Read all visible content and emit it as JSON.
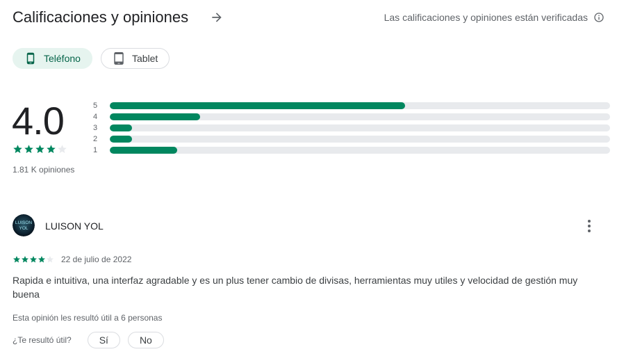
{
  "header": {
    "title": "Calificaciones y opiniones",
    "verified_text": "Las calificaciones y opiniones están verificadas",
    "arrow_icon": "arrow-right-icon",
    "info_icon": "info-icon"
  },
  "device_tabs": [
    {
      "label": "Teléfono",
      "icon": "phone-icon",
      "selected": true
    },
    {
      "label": "Tablet",
      "icon": "tablet-icon",
      "selected": false
    }
  ],
  "summary": {
    "score": "4.0",
    "stars_filled": 4,
    "stars_total": 5,
    "count_text": "1.81 K opiniones"
  },
  "distribution": [
    {
      "label": "5",
      "fraction": 0.59
    },
    {
      "label": "4",
      "fraction": 0.18
    },
    {
      "label": "3",
      "fraction": 0.045
    },
    {
      "label": "2",
      "fraction": 0.045
    },
    {
      "label": "1",
      "fraction": 0.135
    }
  ],
  "review": {
    "author": "LUISON YOL",
    "avatar_text_top": "LUISON",
    "avatar_text_bottom": "YOL",
    "rating": 4,
    "date": "22 de julio de 2022",
    "text": "Rapida e intuitiva, una interfaz agradable y es un plus tener cambio de divisas, herramientas muy utiles y velocidad de gestión muy buena",
    "helpful_count_text": "Esta opinión les resultó útil a 6 personas",
    "helpful_question": "¿Te resultó útil?",
    "yes_label": "Sí",
    "no_label": "No"
  },
  "colors": {
    "accent": "#01875f",
    "chip_selected_bg": "#e6f4ef",
    "track": "#e8eaed",
    "empty_star": "#e8eaed"
  }
}
